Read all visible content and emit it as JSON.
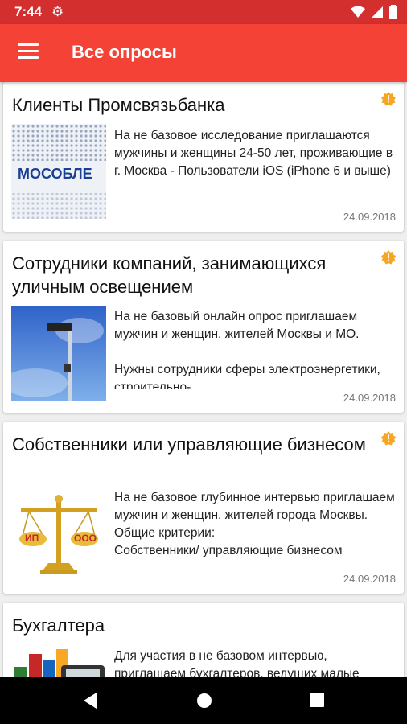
{
  "status_bar": {
    "time": "7:44"
  },
  "app_bar": {
    "title": "Все опросы"
  },
  "cards": [
    {
      "title": "Клиенты Промсвязьбанка",
      "description": "На не базовое исследование приглашаются мужчины и женщины 24-50 лет, проживающие в г. Москва - Пользователи iOS (iPhone 6 и выше)",
      "date": "24.09.2018",
      "thumb_text": "МОСОБЛЕ"
    },
    {
      "title": "Сотрудники компаний, занимающихся уличным освещением",
      "description": "На не базовый онлайн опрос приглашаем мужчин и женщин, жителей Москвы и МО.\n\nНужны сотрудники сферы электроэнергетики, строительно-",
      "date": "24.09.2018"
    },
    {
      "title": "Собственники или управляющие бизнесом",
      "description": "На не базовое глубинное интервью приглашаем мужчин и женщин, жителей города Москвы.\nОбщие критерии:\nСобственники/ управляющие бизнесом",
      "date": "24.09.2018",
      "thumb_labels": {
        "left": "ИП",
        "right": "ООО"
      }
    },
    {
      "title": "Бухгалтера",
      "description": "Для участия в не базовом интервью, приглашаем бухгалтеров, ведущих малые",
      "date": ""
    }
  ],
  "colors": {
    "status_bar": "#d32f2f",
    "app_bar": "#f44336",
    "badge": "#f5a623"
  }
}
